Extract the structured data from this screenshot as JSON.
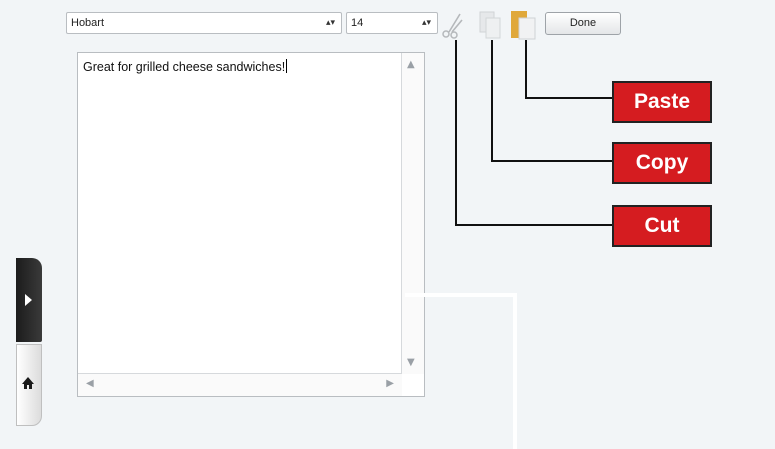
{
  "toolbar": {
    "font_value": "Hobart",
    "size_value": "14",
    "cut_icon": "scissors-icon",
    "copy_icon": "copy-icon",
    "paste_icon": "paste-icon",
    "done_label": "Done"
  },
  "editor": {
    "text": "Great for grilled cheese sandwiches!"
  },
  "callouts": {
    "paste": "Paste",
    "copy": "Copy",
    "cut": "Cut",
    "color": "#d51c20"
  },
  "side_tab": {
    "expand_icon": "play-arrow-icon",
    "home_icon": "home-icon"
  }
}
